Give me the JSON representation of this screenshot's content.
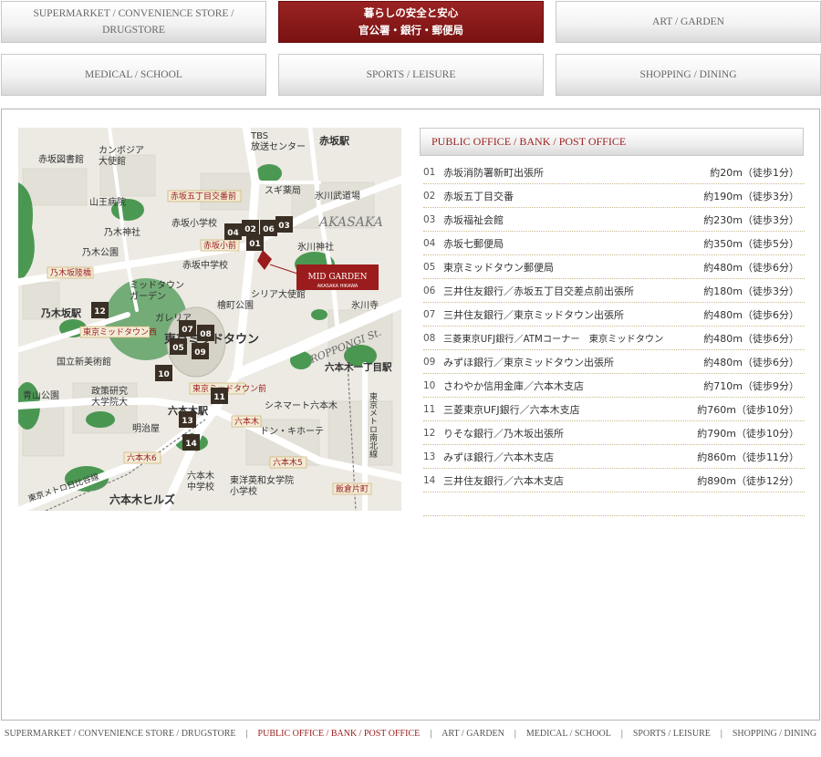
{
  "tabs": [
    {
      "label": "SUPERMARKET / CONVENIENCE STORE / DRUGSTORE"
    },
    {
      "line1": "暮らしの安全と安心",
      "line2": "官公署・銀行・郵便局"
    },
    {
      "label": "ART / GARDEN"
    },
    {
      "label": "MEDICAL / SCHOOL"
    },
    {
      "label": "SPORTS / LEISURE"
    },
    {
      "label": "SHOPPING / DINING"
    }
  ],
  "list_title": "PUBLIC OFFICE / BANK / POST OFFICE",
  "facilities": [
    {
      "no": "01",
      "name": "赤坂消防署新町出張所",
      "dist": "約20m（徒歩1分）"
    },
    {
      "no": "02",
      "name": "赤坂五丁目交番",
      "dist": "約190m（徒歩3分）"
    },
    {
      "no": "03",
      "name": "赤坂福祉会館",
      "dist": "約230m（徒歩3分）"
    },
    {
      "no": "04",
      "name": "赤坂七郵便局",
      "dist": "約350m（徒歩5分）"
    },
    {
      "no": "05",
      "name": "東京ミッドタウン郵便局",
      "dist": "約480m（徒歩6分）"
    },
    {
      "no": "06",
      "name": "三井住友銀行／赤坂五丁目交差点前出張所",
      "dist": "約180m（徒歩3分）"
    },
    {
      "no": "07",
      "name": "三井住友銀行／東京ミッドタウン出張所",
      "dist": "約480m（徒歩6分）"
    },
    {
      "no": "08",
      "name": "三菱東京UFJ銀行／ATMコーナー　東京ミッドタウン",
      "dist": "約480m（徒歩6分）"
    },
    {
      "no": "09",
      "name": "みずほ銀行／東京ミッドタウン出張所",
      "dist": "約480m（徒歩6分）"
    },
    {
      "no": "10",
      "name": "さわやか信用金庫／六本木支店",
      "dist": "約710m（徒歩9分）"
    },
    {
      "no": "11",
      "name": "三菱東京UFJ銀行／六本木支店",
      "dist": "約760m（徒歩10分）"
    },
    {
      "no": "12",
      "name": "りそな銀行／乃木坂出張所",
      "dist": "約790m（徒歩10分）"
    },
    {
      "no": "13",
      "name": "みずほ銀行／六本木支店",
      "dist": "約860m（徒歩11分）"
    },
    {
      "no": "14",
      "name": "三井住友銀行／六本木支店",
      "dist": "約890m（徒歩12分）"
    }
  ],
  "map": {
    "labels": {
      "akasaka_library": "赤坂図書館",
      "cambodia": "カンボジア",
      "cambodia2": "大使館",
      "tbs": "TBS",
      "tbs2": "放送センター",
      "akasaka_station": "赤坂駅",
      "sanno": "山王病院",
      "suginoyakkyoku": "スギ薬局",
      "akasaka5": "赤坂五丁目交番前",
      "hikawa_budojo": "氷川武道場",
      "akasaka_en": "AKASAKA",
      "nogi_shrine": "乃木神社",
      "akasaka_elem": "赤坂小学校",
      "nogi_park": "乃木公園",
      "akasaka_elem_mae": "赤坂小前",
      "hikawa_shrine": "氷川神社",
      "nogizaka_rikkyo": "乃木坂陸橋",
      "akasaka_jhs": "赤坂中学校",
      "midtown_garden": "ミッドタウン",
      "midtown_garden2": "ガーデン",
      "syria": "シリア大使館",
      "hinokicho": "檜町公園",
      "hikawa_temple": "氷川寺",
      "nogizaka_st": "乃木坂駅",
      "galleria": "ガレリア",
      "midtown_nishi": "東京ミッドタウン西",
      "tokyo_midtown": "東京ミッドタウン",
      "roppongi_st": "ROPPONGI St.",
      "national_art": "国立新美術館",
      "roppongi1": "六本木一丁目駅",
      "aoyama_park": "青山公園",
      "grips": "政策研究",
      "grips2": "大学院大",
      "midtown_mae": "東京ミッドタウン前",
      "roppongi_station": "六本木駅",
      "cinemart": "シネマート六本木",
      "meijiya": "明治屋",
      "roppongi_sig": "六本木",
      "donki": "ドン・キホーテ",
      "tokyometro_namboku": "東京メトロ南北線",
      "roppongi6": "六本木6",
      "roppongi5": "六本木5",
      "tokyometro_hibiya": "東京メトロ日比谷線",
      "roppongi_jhs": "六本木",
      "roppongi_jhs2": "中学校",
      "toyo_eiwa": "東洋英和女学院",
      "toyo_eiwa2": "小学校",
      "iikuracho": "飯倉片町",
      "roppongi_hills": "六本木ヒルズ",
      "mid_garden": "MID GARDEN",
      "mid_garden_sub": "AKASAKA HIKAWA"
    },
    "colors": {
      "park": "#2f8a3a",
      "road": "#ffffff",
      "block": "#e6e5de",
      "marker": "#3a2f24",
      "brand": "#9b1c1c"
    }
  },
  "footer": [
    {
      "label": "SUPERMARKET / CONVENIENCE STORE / DRUGSTORE",
      "current": false
    },
    {
      "label": "PUBLIC OFFICE / BANK / POST OFFICE",
      "current": true
    },
    {
      "label": "ART / GARDEN",
      "current": false
    },
    {
      "label": "MEDICAL / SCHOOL",
      "current": false
    },
    {
      "label": "SPORTS / LEISURE",
      "current": false
    },
    {
      "label": "SHOPPING / DINING",
      "current": false
    }
  ]
}
